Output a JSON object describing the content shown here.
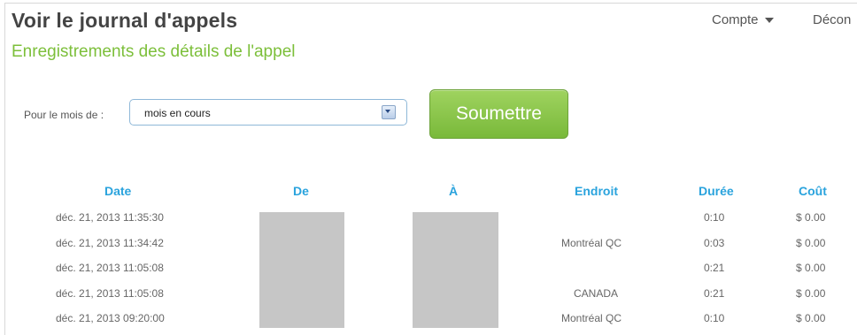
{
  "header": {
    "title": "Voir le journal d'appels",
    "subtitle": "Enregistrements des détails de l'appel",
    "account_menu": "Compte",
    "logout": "Décon"
  },
  "filter": {
    "month_label": "Pour le mois de :",
    "month_value": "mois en cours",
    "submit_label": "Soumettre"
  },
  "table": {
    "columns": [
      "Date",
      "De",
      "À",
      "Endroit",
      "Durée",
      "Coût"
    ],
    "rows": [
      {
        "date": "déc. 21, 2013 11:35:30",
        "endroit": "",
        "duree": "0:10",
        "cout": "$ 0.00"
      },
      {
        "date": "déc. 21, 2013 11:34:42",
        "endroit": "Montréal QC",
        "duree": "0:03",
        "cout": "$ 0.00"
      },
      {
        "date": "déc. 21, 2013 11:05:08",
        "endroit": "",
        "duree": "0:21",
        "cout": "$ 0.00"
      },
      {
        "date": "déc. 21, 2013 11:05:08",
        "endroit": "CANADA",
        "duree": "0:21",
        "cout": "$ 0.00"
      },
      {
        "date": "déc. 21, 2013 09:20:00",
        "endroit": "Montréal QC",
        "duree": "0:10",
        "cout": "$ 0.00"
      }
    ]
  },
  "colors": {
    "accent_green": "#7cbf3a",
    "header_blue": "#2aa3dd",
    "redaction_gray": "#c6c6c6"
  }
}
